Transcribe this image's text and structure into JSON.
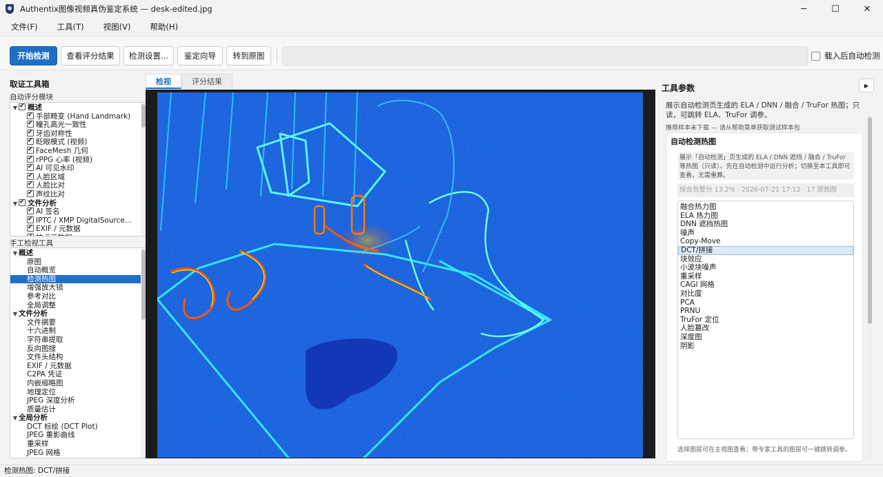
{
  "window": {
    "title": "Authentix图像视频真伪鉴定系统 — desk-edited.jpg",
    "minimize": "─",
    "maximize": "☐",
    "close": "✕"
  },
  "menu": [
    "文件(F)",
    "工具(T)",
    "视图(V)",
    "帮助(H)"
  ],
  "toolbar": {
    "start": "开始检测",
    "view_results": "查看评分结果",
    "settings": "检测设置...",
    "wizard": "鉴定向导",
    "goto_original": "转到原图",
    "auto_detect_label": "载入后自动检测"
  },
  "left": {
    "title": "取证工具箱",
    "auto_title": "自动评分模块",
    "auto_tree": [
      {
        "label": "概述",
        "level": 0,
        "bold": true,
        "checked": true
      },
      {
        "label": "手部畸变 (Hand Landmark)",
        "level": 1,
        "checked": true
      },
      {
        "label": "瞳孔高光一致性",
        "level": 1,
        "checked": true
      },
      {
        "label": "牙齿对称性",
        "level": 1,
        "checked": true
      },
      {
        "label": "眨眼模式 (视频)",
        "level": 1,
        "checked": true
      },
      {
        "label": "FaceMesh 几何",
        "level": 1,
        "checked": true
      },
      {
        "label": "rPPG 心率 (视频)",
        "level": 1,
        "checked": true
      },
      {
        "label": "AI 可见水印",
        "level": 1,
        "checked": true
      },
      {
        "label": "人脸区域",
        "level": 1,
        "checked": true
      },
      {
        "label": "人脸比对",
        "level": 1,
        "checked": true
      },
      {
        "label": "声纹比对",
        "level": 1,
        "checked": true
      },
      {
        "label": "文件分析",
        "level": 0,
        "bold": true,
        "checked": true
      },
      {
        "label": "AI 签名",
        "level": 1,
        "checked": true
      },
      {
        "label": "IPTC / XMP DigitalSource...",
        "level": 1,
        "checked": true
      },
      {
        "label": "EXIF / 元数据",
        "level": 1,
        "checked": true
      },
      {
        "label": "技术元数据",
        "level": 1,
        "checked": true
      }
    ],
    "manual_title": "手工检视工具",
    "manual_tree": [
      {
        "label": "概述",
        "level": 0,
        "bold": true
      },
      {
        "label": "原图",
        "level": 1
      },
      {
        "label": "自动概览",
        "level": 1
      },
      {
        "label": "检测热图",
        "level": 1,
        "selected": true
      },
      {
        "label": "增强放大镜",
        "level": 1
      },
      {
        "label": "参考对比",
        "level": 1
      },
      {
        "label": "全局调整",
        "level": 1
      },
      {
        "label": "文件分析",
        "level": 0,
        "bold": true
      },
      {
        "label": "文件摘要",
        "level": 1
      },
      {
        "label": "十六进制",
        "level": 1
      },
      {
        "label": "字符串提取",
        "level": 1
      },
      {
        "label": "反向图搜",
        "level": 1
      },
      {
        "label": "文件头结构",
        "level": 1
      },
      {
        "label": "EXIF / 元数据",
        "level": 1
      },
      {
        "label": "C2PA 凭证",
        "level": 1
      },
      {
        "label": "内嵌缩略图",
        "level": 1
      },
      {
        "label": "地理定位",
        "level": 1
      },
      {
        "label": "JPEG 深度分析",
        "level": 1
      },
      {
        "label": "质量估计",
        "level": 1
      },
      {
        "label": "全局分析",
        "level": 0,
        "bold": true
      },
      {
        "label": "DCT 标绘 (DCT Plot)",
        "level": 1
      },
      {
        "label": "JPEG 重影曲线",
        "level": 1
      },
      {
        "label": "重采样",
        "level": 1
      },
      {
        "label": "JPEG 网格",
        "level": 1
      }
    ]
  },
  "center": {
    "tabs": [
      "检视",
      "评分结果"
    ]
  },
  "right": {
    "title": "工具参数",
    "collapse": "▶",
    "desc": "展示自动检测页生成的 ELA / DNN / 融合 / TruFor 热图；只读，可跳转 ELA、TruFor 调参。",
    "hint": "推荐样本未下载 — 请从帮助菜单获取测试样本包",
    "group_title": "自动检测热图",
    "group_desc": "展示「自动检测」页生成的 ELA / DNN 遮挡 / 融合 / TruFor 等热图（只读）。先在自动检测中运行分析；切换至本工具即可查看，无需重算。",
    "group_meta": "综合告警分 13.2%  ·  2026-07-21 17:12  ·  17 层热图",
    "list": [
      "融合热力图",
      "ELA 热力图",
      "DNN 遮挡热图",
      "噪声",
      "Copy-Move",
      "DCT/拼接",
      "块效应",
      "小波块噪声",
      "重采样",
      "CAGI 网格",
      "对比度",
      "PCA",
      "PRNU",
      "TruFor 定位",
      "人脸篡改",
      "深度图",
      "阴影"
    ],
    "selected_index": 5,
    "footer": "选择图层可在主视图查看；带专家工具的图层可一键跳转调参。"
  },
  "status": "检测热图: DCT/拼接"
}
